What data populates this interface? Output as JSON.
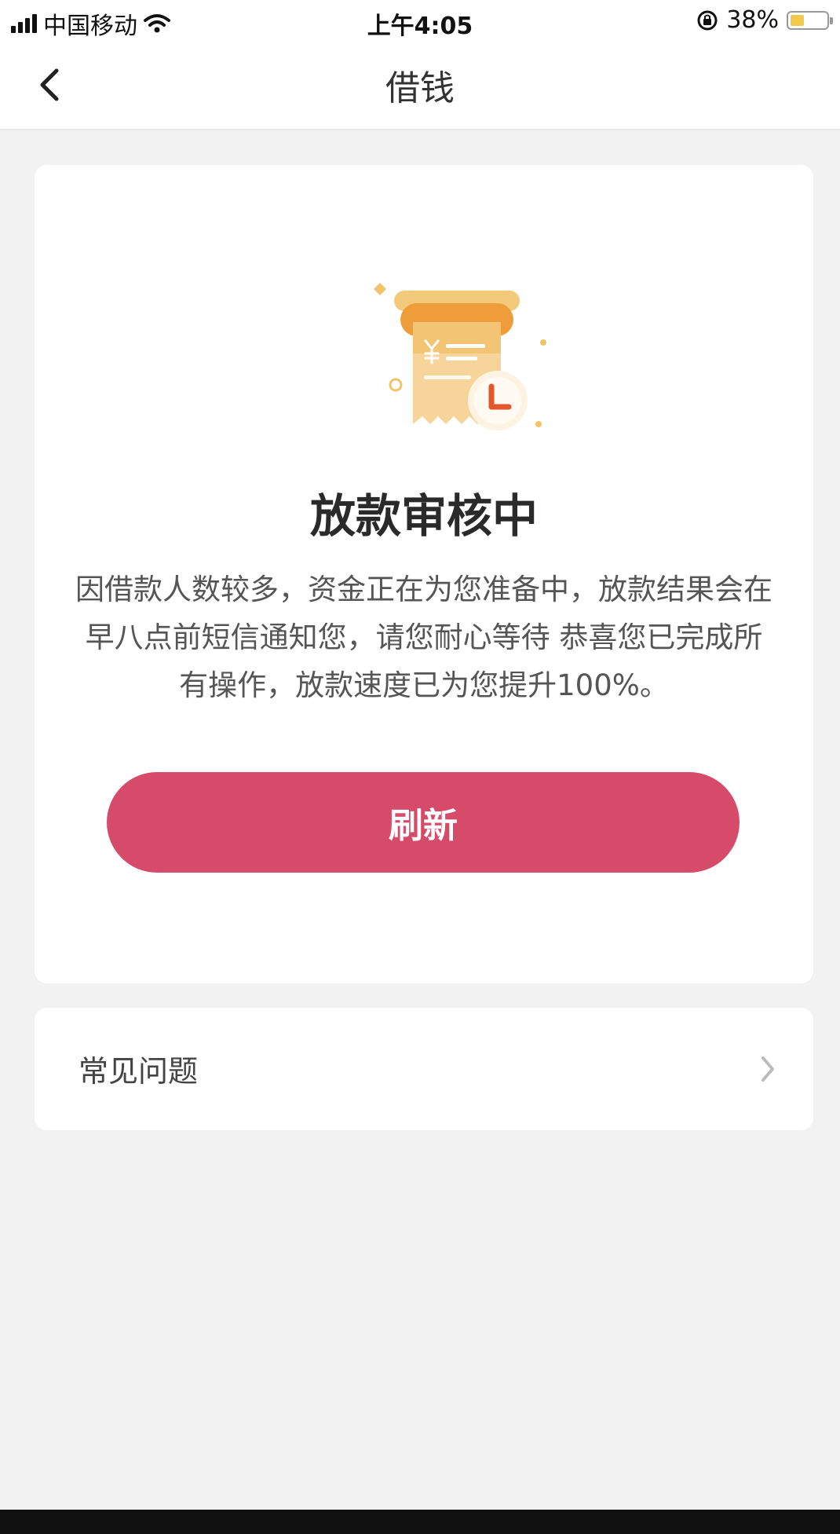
{
  "status_bar": {
    "carrier": "中国移动",
    "time": "上午4:05",
    "battery_percent": "38%",
    "battery_level": 0.38
  },
  "nav": {
    "title": "借钱",
    "back_icon": "chevron-left-icon"
  },
  "card": {
    "illustration_icon": "receipt-clock-icon",
    "status_title": "放款审核中",
    "description": "因借款人数较多，资金正在为您准备中，放款结果会在早八点前短信通知您，请您耐心等待 恭喜您已完成所有操作，放款速度已为您提升100%。",
    "refresh_button": "刷新"
  },
  "faq": {
    "label": "常见问题",
    "chevron_icon": "chevron-right-icon"
  },
  "colors": {
    "accent": "#d64b6a",
    "background": "#f2f2f2",
    "illustration_gold": "#f0b04a"
  }
}
